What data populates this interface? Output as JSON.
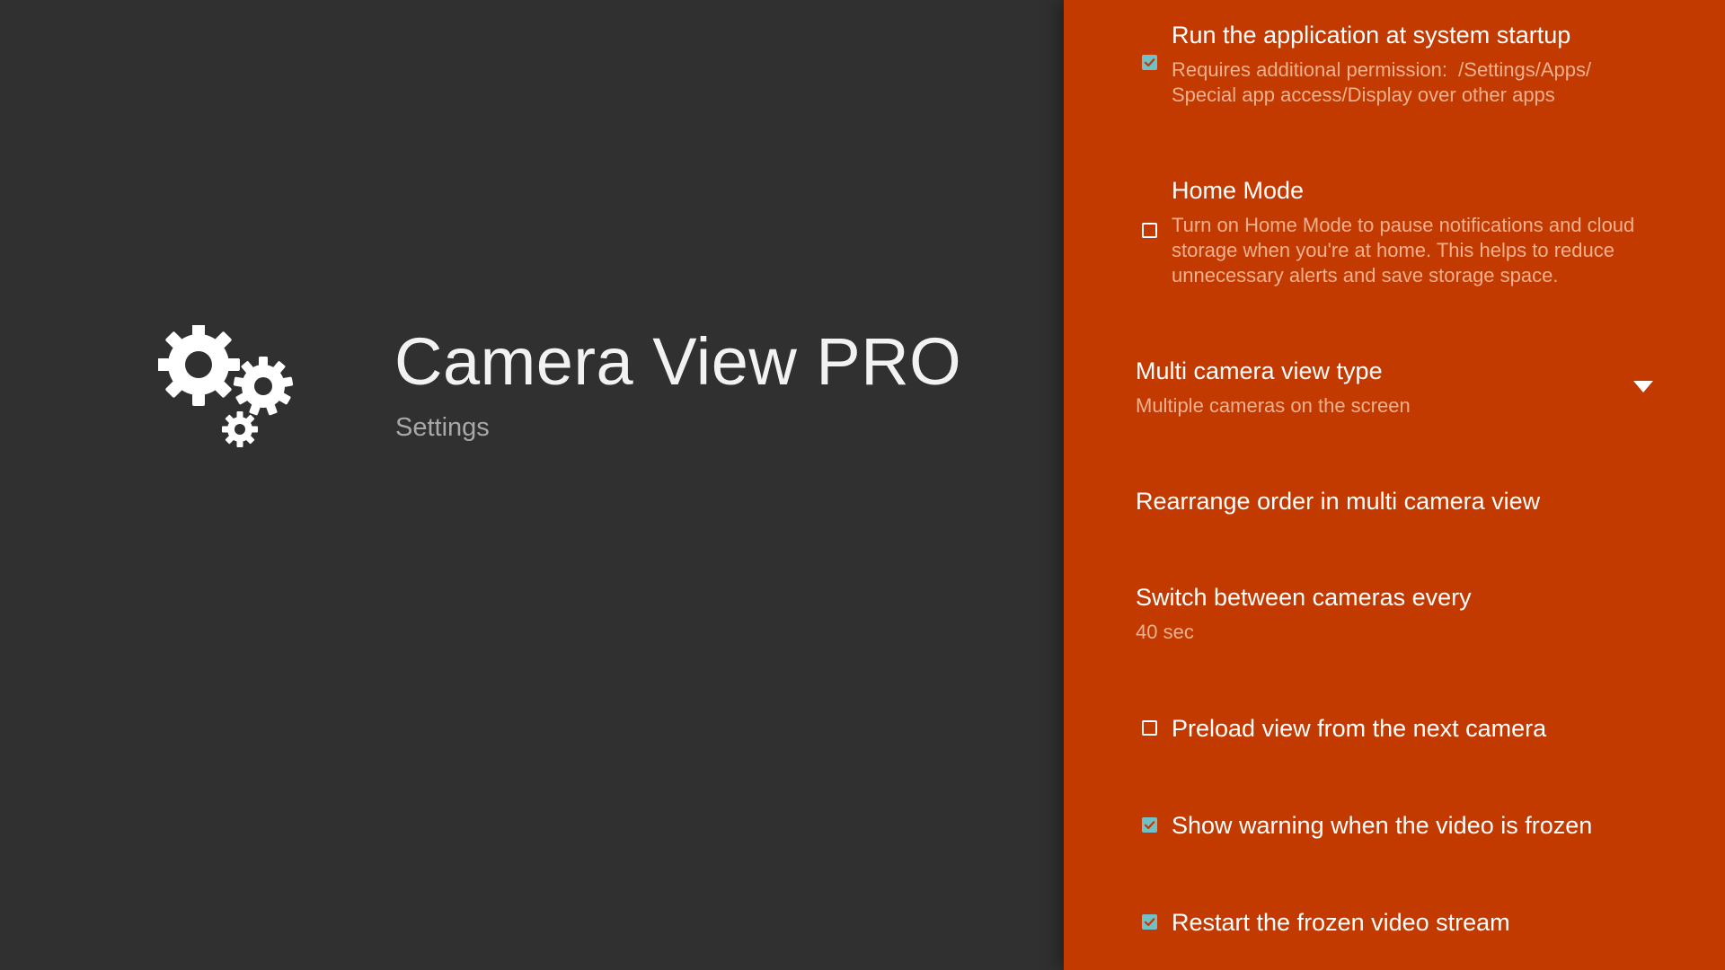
{
  "app": {
    "title": "Camera View PRO",
    "subtitle": "Settings",
    "icon": "gears-icon"
  },
  "colors": {
    "background": "#303030",
    "panel": "#c23a00",
    "title_text": "#f2f2f2",
    "subtitle_text": "#a8a8a8",
    "summary_text": "#f1b08f",
    "checkbox_checked": "#6fc0c8"
  },
  "settings": [
    {
      "type": "checkbox",
      "checked": true,
      "title": "Run the application at system startup",
      "summary": "Requires additional permission:  /Settings/Apps/\nSpecial app access/Display over other apps"
    },
    {
      "type": "checkbox",
      "checked": false,
      "title": "Home Mode",
      "summary": "Turn on Home Mode to pause notifications and cloud\nstorage when you're at home. This helps to reduce\nunnecessary alerts and save storage space."
    },
    {
      "type": "list",
      "title": "Multi camera view type",
      "summary": "Multiple cameras on the screen",
      "icon": "chevron-down-icon"
    },
    {
      "type": "action",
      "title": "Rearrange order in multi camera view"
    },
    {
      "type": "value",
      "title": "Switch between cameras every",
      "summary": "40 sec"
    },
    {
      "type": "checkbox",
      "checked": false,
      "title": "Preload view from the next camera"
    },
    {
      "type": "checkbox",
      "checked": true,
      "title": "Show warning when the video is frozen"
    },
    {
      "type": "checkbox",
      "checked": true,
      "title": "Restart the frozen video stream"
    }
  ]
}
